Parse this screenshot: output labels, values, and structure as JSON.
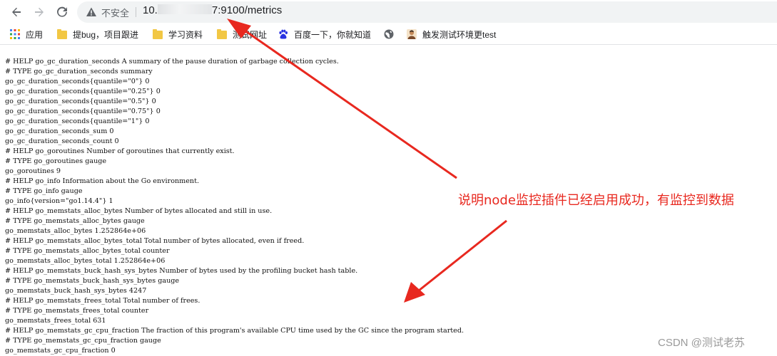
{
  "browser": {
    "insecure_label": "不安全",
    "url_prefix": "10.",
    "url_suffix": "7:9100/metrics"
  },
  "bookmarks": [
    {
      "label": "应用",
      "icon": "apps-grid-icon"
    },
    {
      "label": "提bug，项目跟进",
      "icon": "folder-icon"
    },
    {
      "label": "学习资料",
      "icon": "folder-icon"
    },
    {
      "label": "测试网址",
      "icon": "folder-icon"
    },
    {
      "label": "百度一下，你就知道",
      "icon": "baidu-paw-icon"
    },
    {
      "label": "",
      "icon": "globe-icon"
    },
    {
      "label": "触发测试环境更test",
      "icon": "avatar-icon"
    }
  ],
  "metrics_lines": [
    "# HELP go_gc_duration_seconds A summary of the pause duration of garbage collection cycles.",
    "# TYPE go_gc_duration_seconds summary",
    "go_gc_duration_seconds{quantile=\"0\"} 0",
    "go_gc_duration_seconds{quantile=\"0.25\"} 0",
    "go_gc_duration_seconds{quantile=\"0.5\"} 0",
    "go_gc_duration_seconds{quantile=\"0.75\"} 0",
    "go_gc_duration_seconds{quantile=\"1\"} 0",
    "go_gc_duration_seconds_sum 0",
    "go_gc_duration_seconds_count 0",
    "# HELP go_goroutines Number of goroutines that currently exist.",
    "# TYPE go_goroutines gauge",
    "go_goroutines 9",
    "# HELP go_info Information about the Go environment.",
    "# TYPE go_info gauge",
    "go_info{version=\"go1.14.4\"} 1",
    "# HELP go_memstats_alloc_bytes Number of bytes allocated and still in use.",
    "# TYPE go_memstats_alloc_bytes gauge",
    "go_memstats_alloc_bytes 1.252864e+06",
    "# HELP go_memstats_alloc_bytes_total Total number of bytes allocated, even if freed.",
    "# TYPE go_memstats_alloc_bytes_total counter",
    "go_memstats_alloc_bytes_total 1.252864e+06",
    "# HELP go_memstats_buck_hash_sys_bytes Number of bytes used by the profiling bucket hash table.",
    "# TYPE go_memstats_buck_hash_sys_bytes gauge",
    "go_memstats_buck_hash_sys_bytes 4247",
    "# HELP go_memstats_frees_total Total number of frees.",
    "# TYPE go_memstats_frees_total counter",
    "go_memstats_frees_total 631",
    "# HELP go_memstats_gc_cpu_fraction The fraction of this program's available CPU time used by the GC since the program started.",
    "# TYPE go_memstats_gc_cpu_fraction gauge",
    "go_memstats_gc_cpu_fraction 0"
  ],
  "annotation": {
    "text": "说明node监控插件已经启用成功，有监控到数据",
    "color": "#e8281f"
  },
  "watermark": "CSDN @测试老苏"
}
